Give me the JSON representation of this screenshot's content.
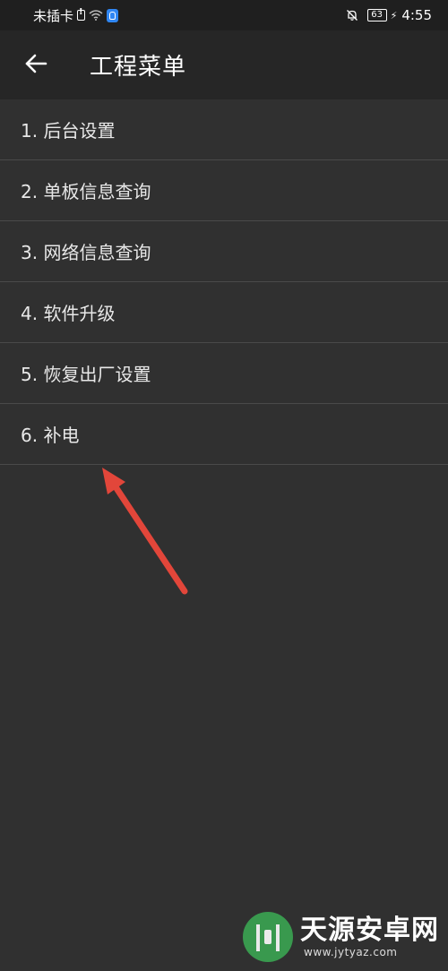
{
  "status_bar": {
    "carrier": "未插卡",
    "battery_level": "63",
    "time": "4:55"
  },
  "toolbar": {
    "title": "工程菜单"
  },
  "menu": {
    "items": [
      {
        "label": "1. 后台设置"
      },
      {
        "label": "2. 单板信息查询"
      },
      {
        "label": "3. 网络信息查询"
      },
      {
        "label": "4. 软件升级"
      },
      {
        "label": "5. 恢复出厂设置"
      },
      {
        "label": "6. 补电"
      }
    ]
  },
  "watermark": {
    "name": "天源安卓网",
    "url": "www.jytyaz.com"
  },
  "colors": {
    "background": "#303030",
    "toolbar": "#262626",
    "status_bar": "#1f1f1f",
    "divider": "#4a4a4a",
    "annotation_arrow": "#e2463a"
  },
  "icons": {
    "back": "arrow-left-icon",
    "sim": "sim-card-icon",
    "wifi": "wifi-icon",
    "shield": "shield-icon",
    "mute": "bell-off-icon",
    "battery": "battery-icon",
    "charging": "bolt-icon"
  }
}
